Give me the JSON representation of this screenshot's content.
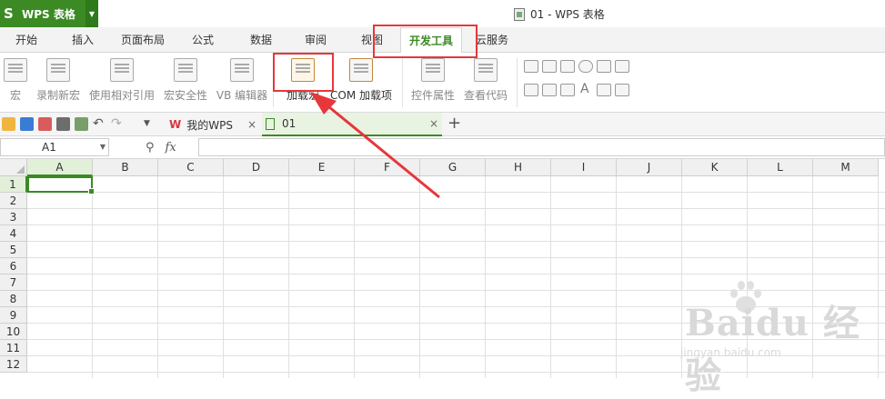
{
  "app": {
    "logo": "S",
    "name": "WPS 表格",
    "window_title": "01 - WPS 表格"
  },
  "ribbon_tabs": [
    {
      "label": "开始"
    },
    {
      "label": "插入"
    },
    {
      "label": "页面布局"
    },
    {
      "label": "公式"
    },
    {
      "label": "数据"
    },
    {
      "label": "审阅"
    },
    {
      "label": "视图"
    },
    {
      "label": "开发工具"
    },
    {
      "label": "云服务"
    }
  ],
  "active_tab": "开发工具",
  "ribbon": {
    "macro": "宏",
    "record_macro": "录制新宏",
    "relative_ref": "使用相对引用",
    "macro_security": "宏安全性",
    "vb_editor": "VB 编辑器",
    "load_macro": "加载宏",
    "com_addin": "COM 加载项",
    "control_props": "控件属性",
    "view_code": "查看代码"
  },
  "doc_tabs": [
    {
      "label": "我的WPS",
      "close": "×"
    },
    {
      "label": "01",
      "close": "×"
    }
  ],
  "new_tab": "+",
  "formula_bar": {
    "name_box": "A1",
    "fx": "fx",
    "value": ""
  },
  "columns": [
    "A",
    "B",
    "C",
    "D",
    "E",
    "F",
    "G",
    "H",
    "I",
    "J",
    "K",
    "L",
    "M"
  ],
  "rows": [
    "1",
    "2",
    "3",
    "4",
    "5",
    "6",
    "7",
    "8",
    "9",
    "10",
    "11",
    "12"
  ],
  "watermark": {
    "brand": "Baidu 经验",
    "url": "jingyan.baidu.com"
  },
  "colors": {
    "accent": "#3b8a24",
    "highlight": "#e6373a"
  }
}
